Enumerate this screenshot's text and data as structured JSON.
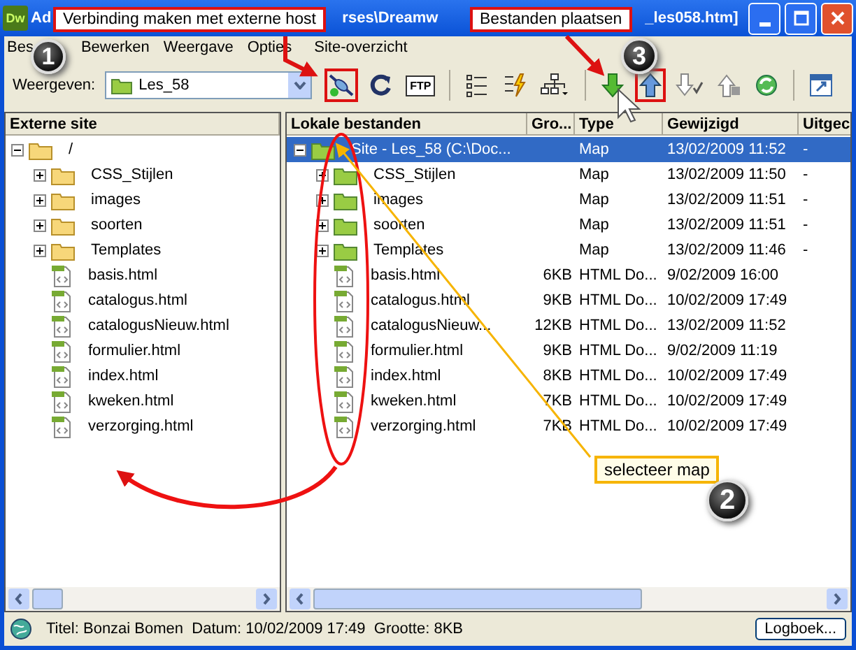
{
  "window": {
    "app_badge": "Dw",
    "title_fragments": [
      "Ad",
      "rses\\Dreamw",
      "_les058.htm]"
    ]
  },
  "menu": [
    "Bes",
    "Bewerken",
    "Weergave",
    "Opties",
    "Site-overzicht"
  ],
  "toolbar": {
    "view_label": "Weergeven:",
    "site_select": "Les_58",
    "ftp_label": "FTP",
    "buttons": [
      {
        "kind": "connect",
        "highlighted": true
      },
      {
        "kind": "refresh",
        "highlighted": false
      },
      {
        "kind": "ftp",
        "highlighted": false
      },
      {
        "kind": "separator"
      },
      {
        "kind": "list",
        "highlighted": false
      },
      {
        "kind": "lightning",
        "highlighted": false
      },
      {
        "kind": "sitemap",
        "highlighted": false
      },
      {
        "kind": "separator"
      },
      {
        "kind": "get",
        "highlighted": false
      },
      {
        "kind": "put",
        "highlighted": true
      },
      {
        "kind": "checkout",
        "highlighted": false
      },
      {
        "kind": "checkin",
        "highlighted": false
      },
      {
        "kind": "sync",
        "highlighted": false
      },
      {
        "kind": "separator"
      },
      {
        "kind": "expand",
        "highlighted": false
      }
    ]
  },
  "remote_pane": {
    "header": "Externe site",
    "tree": {
      "name": "/",
      "kind": "folder",
      "expanded": true,
      "children": [
        {
          "name": "CSS_Stijlen",
          "kind": "folder",
          "expanded": false
        },
        {
          "name": "images",
          "kind": "folder",
          "expanded": false
        },
        {
          "name": "soorten",
          "kind": "folder",
          "expanded": false
        },
        {
          "name": "Templates",
          "kind": "folder",
          "expanded": false
        },
        {
          "name": "basis.html",
          "kind": "file"
        },
        {
          "name": "catalogus.html",
          "kind": "file"
        },
        {
          "name": "catalogusNieuw.html",
          "kind": "file"
        },
        {
          "name": "formulier.html",
          "kind": "file"
        },
        {
          "name": "index.html",
          "kind": "file"
        },
        {
          "name": "kweken.html",
          "kind": "file"
        },
        {
          "name": "verzorging.html",
          "kind": "file"
        }
      ]
    }
  },
  "local_pane": {
    "columns": [
      "Lokale bestanden",
      "Gro...",
      "Type",
      "Gewijzigd",
      "Uitgec"
    ],
    "tree": {
      "name": "Site - Les_58 (C:\\Doc...",
      "kind": "folder",
      "expanded": true,
      "selected": true,
      "type": "Map",
      "modified": "13/02/2009 11:52",
      "checked_out": "-",
      "children": [
        {
          "name": "CSS_Stijlen",
          "kind": "folder",
          "expanded": false,
          "selected": false,
          "type": "Map",
          "modified": "13/02/2009 11:50",
          "checked_out": "-"
        },
        {
          "name": "images",
          "kind": "folder",
          "expanded": false,
          "selected": false,
          "type": "Map",
          "modified": "13/02/2009 11:51",
          "checked_out": "-"
        },
        {
          "name": "soorten",
          "kind": "folder",
          "expanded": false,
          "selected": false,
          "type": "Map",
          "modified": "13/02/2009 11:51",
          "checked_out": "-"
        },
        {
          "name": "Templates",
          "kind": "folder",
          "expanded": false,
          "selected": false,
          "type": "Map",
          "modified": "13/02/2009 11:46",
          "checked_out": "-"
        },
        {
          "name": "basis.html",
          "kind": "file",
          "selected": false,
          "size": "6KB",
          "type": "HTML Do...",
          "modified": "9/02/2009 16:00"
        },
        {
          "name": "catalogus.html",
          "kind": "file",
          "selected": false,
          "size": "9KB",
          "type": "HTML Do...",
          "modified": "10/02/2009 17:49"
        },
        {
          "name": "catalogusNieuw...",
          "kind": "file",
          "selected": false,
          "size": "12KB",
          "type": "HTML Do...",
          "modified": "13/02/2009 11:52"
        },
        {
          "name": "formulier.html",
          "kind": "file",
          "selected": false,
          "size": "9KB",
          "type": "HTML Do...",
          "modified": "9/02/2009 11:19"
        },
        {
          "name": "index.html",
          "kind": "file",
          "selected": false,
          "size": "8KB",
          "type": "HTML Do...",
          "modified": "10/02/2009 17:49"
        },
        {
          "name": "kweken.html",
          "kind": "file",
          "selected": false,
          "size": "7KB",
          "type": "HTML Do...",
          "modified": "10/02/2009 17:49"
        },
        {
          "name": "verzorging.html",
          "kind": "file",
          "selected": false,
          "size": "7KB",
          "type": "HTML Do...",
          "modified": "10/02/2009 17:49"
        }
      ]
    }
  },
  "status_bar": {
    "text": "Titel: Bonzai Bomen  Datum: 10/02/2009 17:49  Grootte: 8KB",
    "button": "Logboek..."
  },
  "annotations": {
    "callouts": [
      {
        "text": "Verbinding maken met externe host",
        "kind": "red"
      },
      {
        "text": "Bestanden plaatsen",
        "kind": "red"
      },
      {
        "text": "selecteer map",
        "kind": "yellow"
      }
    ],
    "badges": [
      "1",
      "3",
      "2"
    ]
  }
}
